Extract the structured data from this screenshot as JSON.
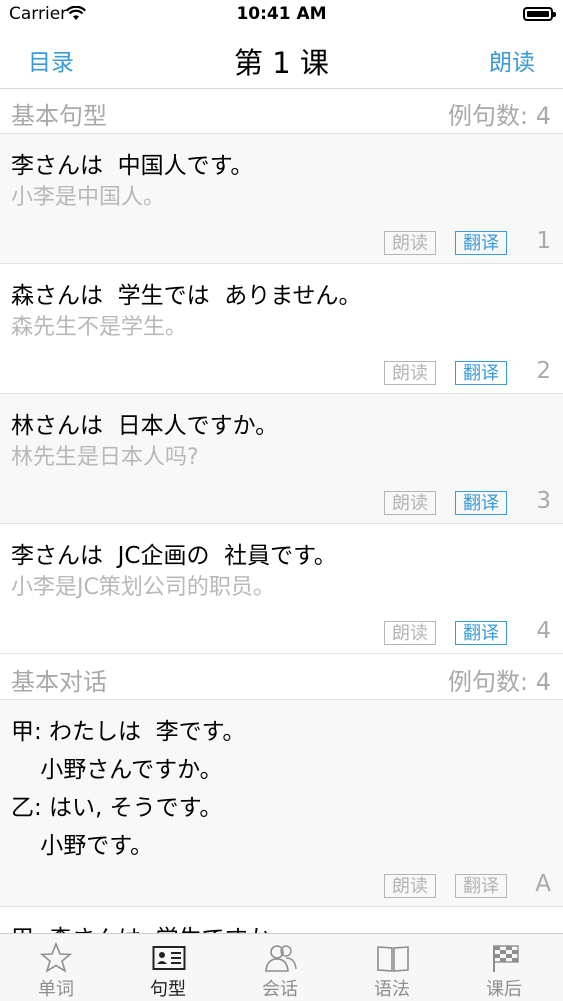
{
  "status_bar": {
    "carrier": "Carrier",
    "time": "10:41 AM"
  },
  "nav": {
    "left": "目录",
    "title": "第 1 课",
    "right": "朗读"
  },
  "sections": [
    {
      "title": "基本句型",
      "count": "例句数: 4"
    },
    {
      "title": "基本对话",
      "count": "例句数: 4"
    }
  ],
  "sentences": [
    {
      "jp": "李さんは  中国人です。",
      "cn": "小李是中国人。",
      "read": "朗读",
      "translate": "翻译",
      "num": "1"
    },
    {
      "jp": "森さんは  学生では  ありません。",
      "cn": "森先生不是学生。",
      "read": "朗读",
      "translate": "翻译",
      "num": "2"
    },
    {
      "jp": "林さんは  日本人ですか。",
      "cn": "林先生是日本人吗?",
      "read": "朗读",
      "translate": "翻译",
      "num": "3"
    },
    {
      "jp": "李さんは  JC企画の  社員です。",
      "cn": "小李是JC策划公司的职员。",
      "read": "朗读",
      "translate": "翻译",
      "num": "4"
    }
  ],
  "dialogue": {
    "lines": [
      "甲: わたしは  李です。",
      "    小野さんですか。",
      "乙: はい, そうです。",
      "    小野です。"
    ],
    "read": "朗读",
    "translate": "翻译",
    "num": "A"
  },
  "dialogue_next": {
    "line": "甲: 森さんは  学生ですか。"
  },
  "tabs": [
    {
      "label": "单词",
      "icon": "star-icon"
    },
    {
      "label": "句型",
      "icon": "id-card-icon",
      "active": true
    },
    {
      "label": "会话",
      "icon": "people-icon"
    },
    {
      "label": "语法",
      "icon": "book-icon"
    },
    {
      "label": "课后",
      "icon": "checkered-flag-icon"
    }
  ],
  "colors": {
    "accent": "#3a9bd9",
    "muted": "#a9a9a9"
  }
}
